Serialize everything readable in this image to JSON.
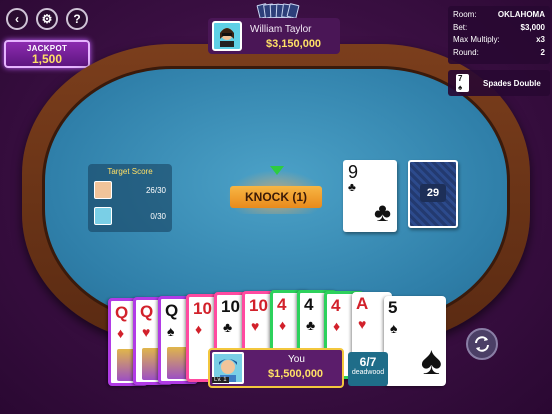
{
  "buttons": {
    "back": "‹",
    "settings": "⚙",
    "help": "?"
  },
  "jackpot": {
    "label": "JACKPOT",
    "value": "1,500"
  },
  "opponent": {
    "name": "William Taylor",
    "money": "$3,150,000"
  },
  "info": {
    "room_label": "Room:",
    "room": "OKLAHOMA",
    "bet_label": "Bet:",
    "bet": "$3,000",
    "maxmult_label": "Max Multiply:",
    "maxmult": "x3",
    "round_label": "Round:",
    "round": "2"
  },
  "spades_double": {
    "card_rank": "7",
    "card_suit": "♠",
    "label": "Spades Double"
  },
  "target_score": {
    "title": "Target Score",
    "players": [
      {
        "score": "26/30"
      },
      {
        "score": "0/30"
      }
    ]
  },
  "knock": {
    "label": "KNOCK (1)"
  },
  "discard": {
    "rank": "9",
    "suit": "♣"
  },
  "stock": {
    "count": "29"
  },
  "hand": [
    {
      "rank": "Q",
      "suit": "♦",
      "color": "red",
      "border": "purple",
      "face": true
    },
    {
      "rank": "Q",
      "suit": "♥",
      "color": "red",
      "border": "purple",
      "face": true
    },
    {
      "rank": "Q",
      "suit": "♠",
      "color": "black",
      "border": "purple",
      "face": true
    },
    {
      "rank": "10",
      "suit": "♦",
      "color": "red",
      "border": "pinkc",
      "face": false
    },
    {
      "rank": "10",
      "suit": "♣",
      "color": "black",
      "border": "pinkc",
      "face": false
    },
    {
      "rank": "10",
      "suit": "♥",
      "color": "red",
      "border": "pinkc",
      "face": false
    },
    {
      "rank": "4",
      "suit": "♦",
      "color": "red",
      "border": "greenc",
      "face": false
    },
    {
      "rank": "4",
      "suit": "♣",
      "color": "black",
      "border": "greenc",
      "face": false
    },
    {
      "rank": "4",
      "suit": "♦",
      "color": "red",
      "border": "greenc",
      "face": false
    },
    {
      "rank": "A",
      "suit": "♥",
      "color": "red",
      "border": "",
      "face": false
    },
    {
      "rank": "5",
      "suit": "♠",
      "color": "black",
      "border": "",
      "face": false
    }
  ],
  "me": {
    "name": "You",
    "money": "$1,500,000",
    "level": "Lv. 1"
  },
  "deadwood": {
    "value": "6/7",
    "label": "deadwood"
  },
  "colors": {
    "felt": "#3a8fb8",
    "rim": "#6b3416",
    "accent": "#ffe066",
    "bg": "#4a1452"
  }
}
